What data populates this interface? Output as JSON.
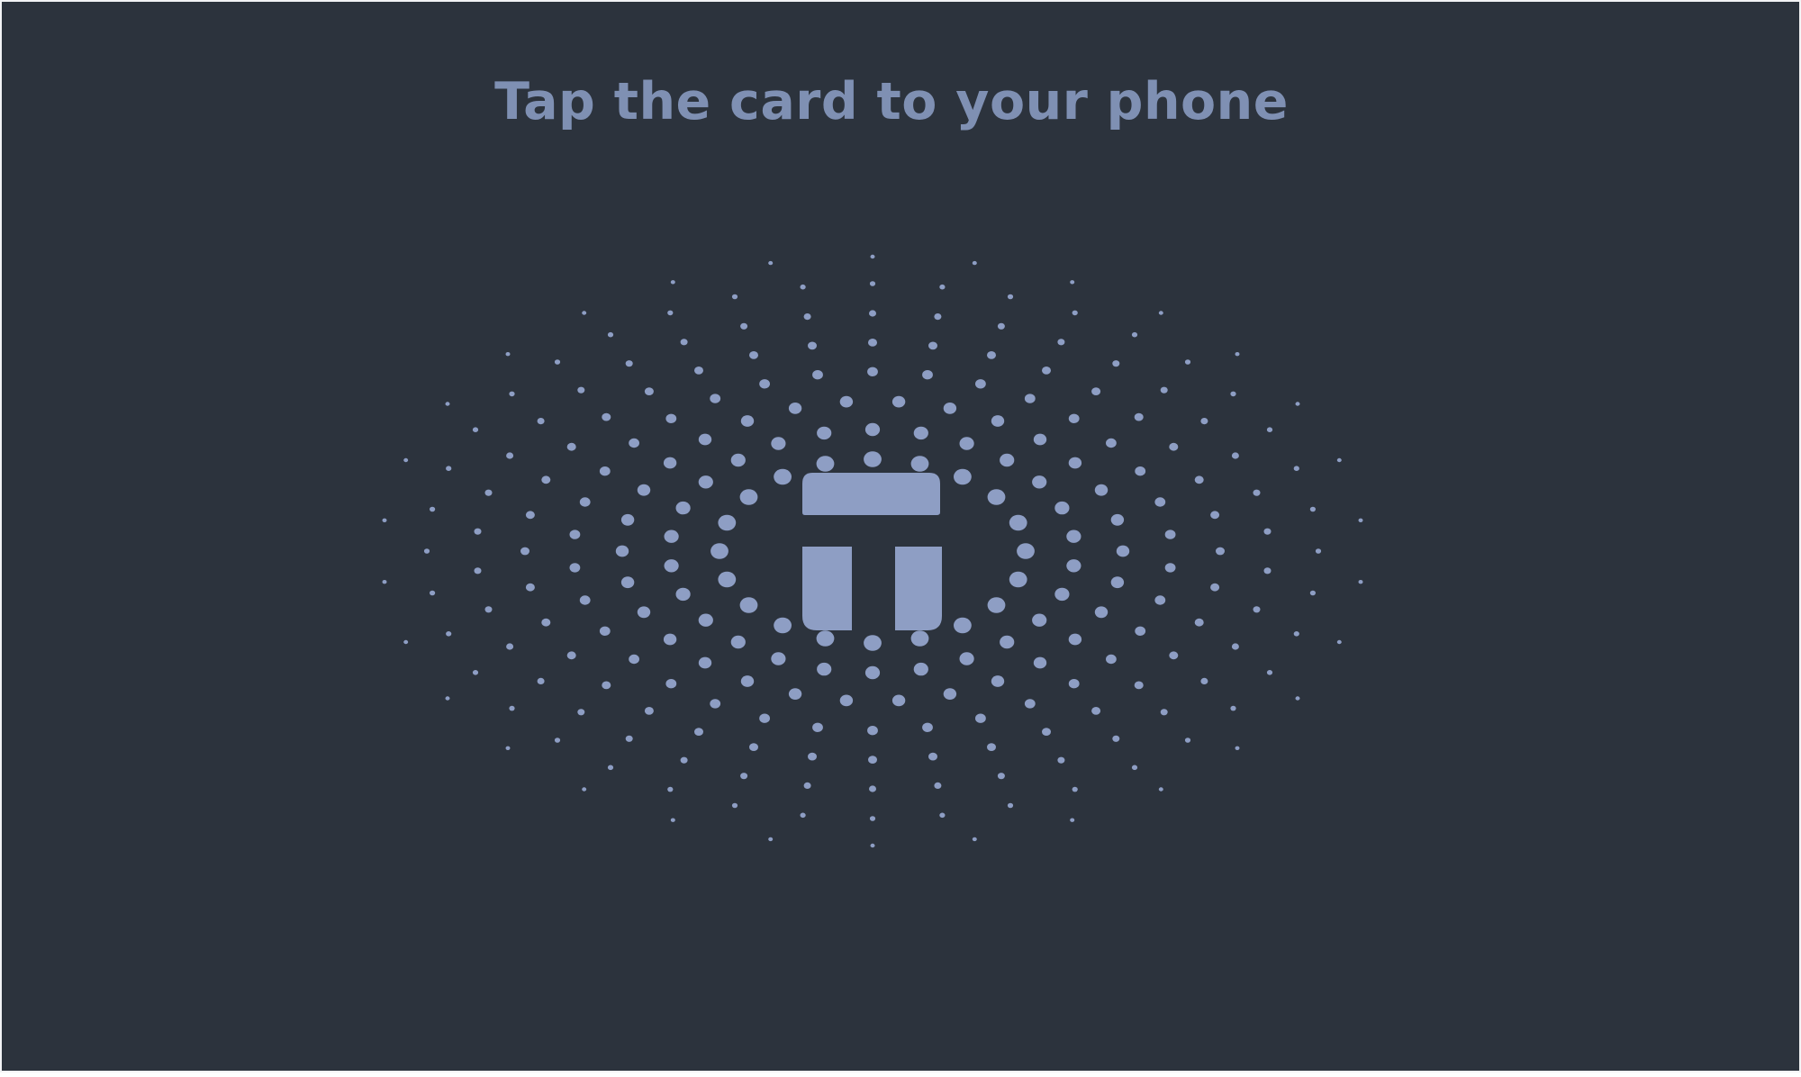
{
  "prompt": {
    "title": "Tap the card to your phone"
  },
  "graphic": {
    "logo_icon": "tap-logo-icon",
    "pattern_icon": "radiating-dots-icon"
  },
  "colors": {
    "background": "#2c333d",
    "accent": "#7f90b3",
    "dot": "#8e9ec4",
    "border": "#f2f3f5"
  }
}
